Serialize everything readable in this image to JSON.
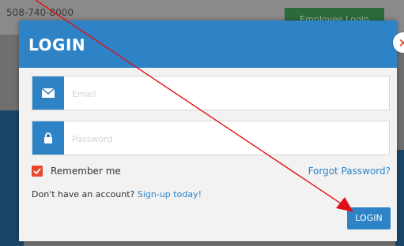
{
  "background": {
    "phone": "508-740-8000",
    "employee_login": "Employee Login"
  },
  "modal": {
    "title": "LOGIN",
    "close_symbol": "×",
    "email_placeholder": "Email",
    "password_placeholder": "Password",
    "remember_label": "Remember me",
    "remember_checked": true,
    "forgot_label": "Forgot Password?",
    "signup_prompt": "Don't have an account?",
    "signup_link": "Sign-up today!",
    "login_button": "LOGIN"
  },
  "icons": {
    "email": "envelope-icon",
    "password": "lock-icon",
    "checkbox": "check-icon"
  },
  "colors": {
    "accent": "#2d83c6",
    "checkbox": "#e8472e",
    "annotation": "#e0101a"
  }
}
